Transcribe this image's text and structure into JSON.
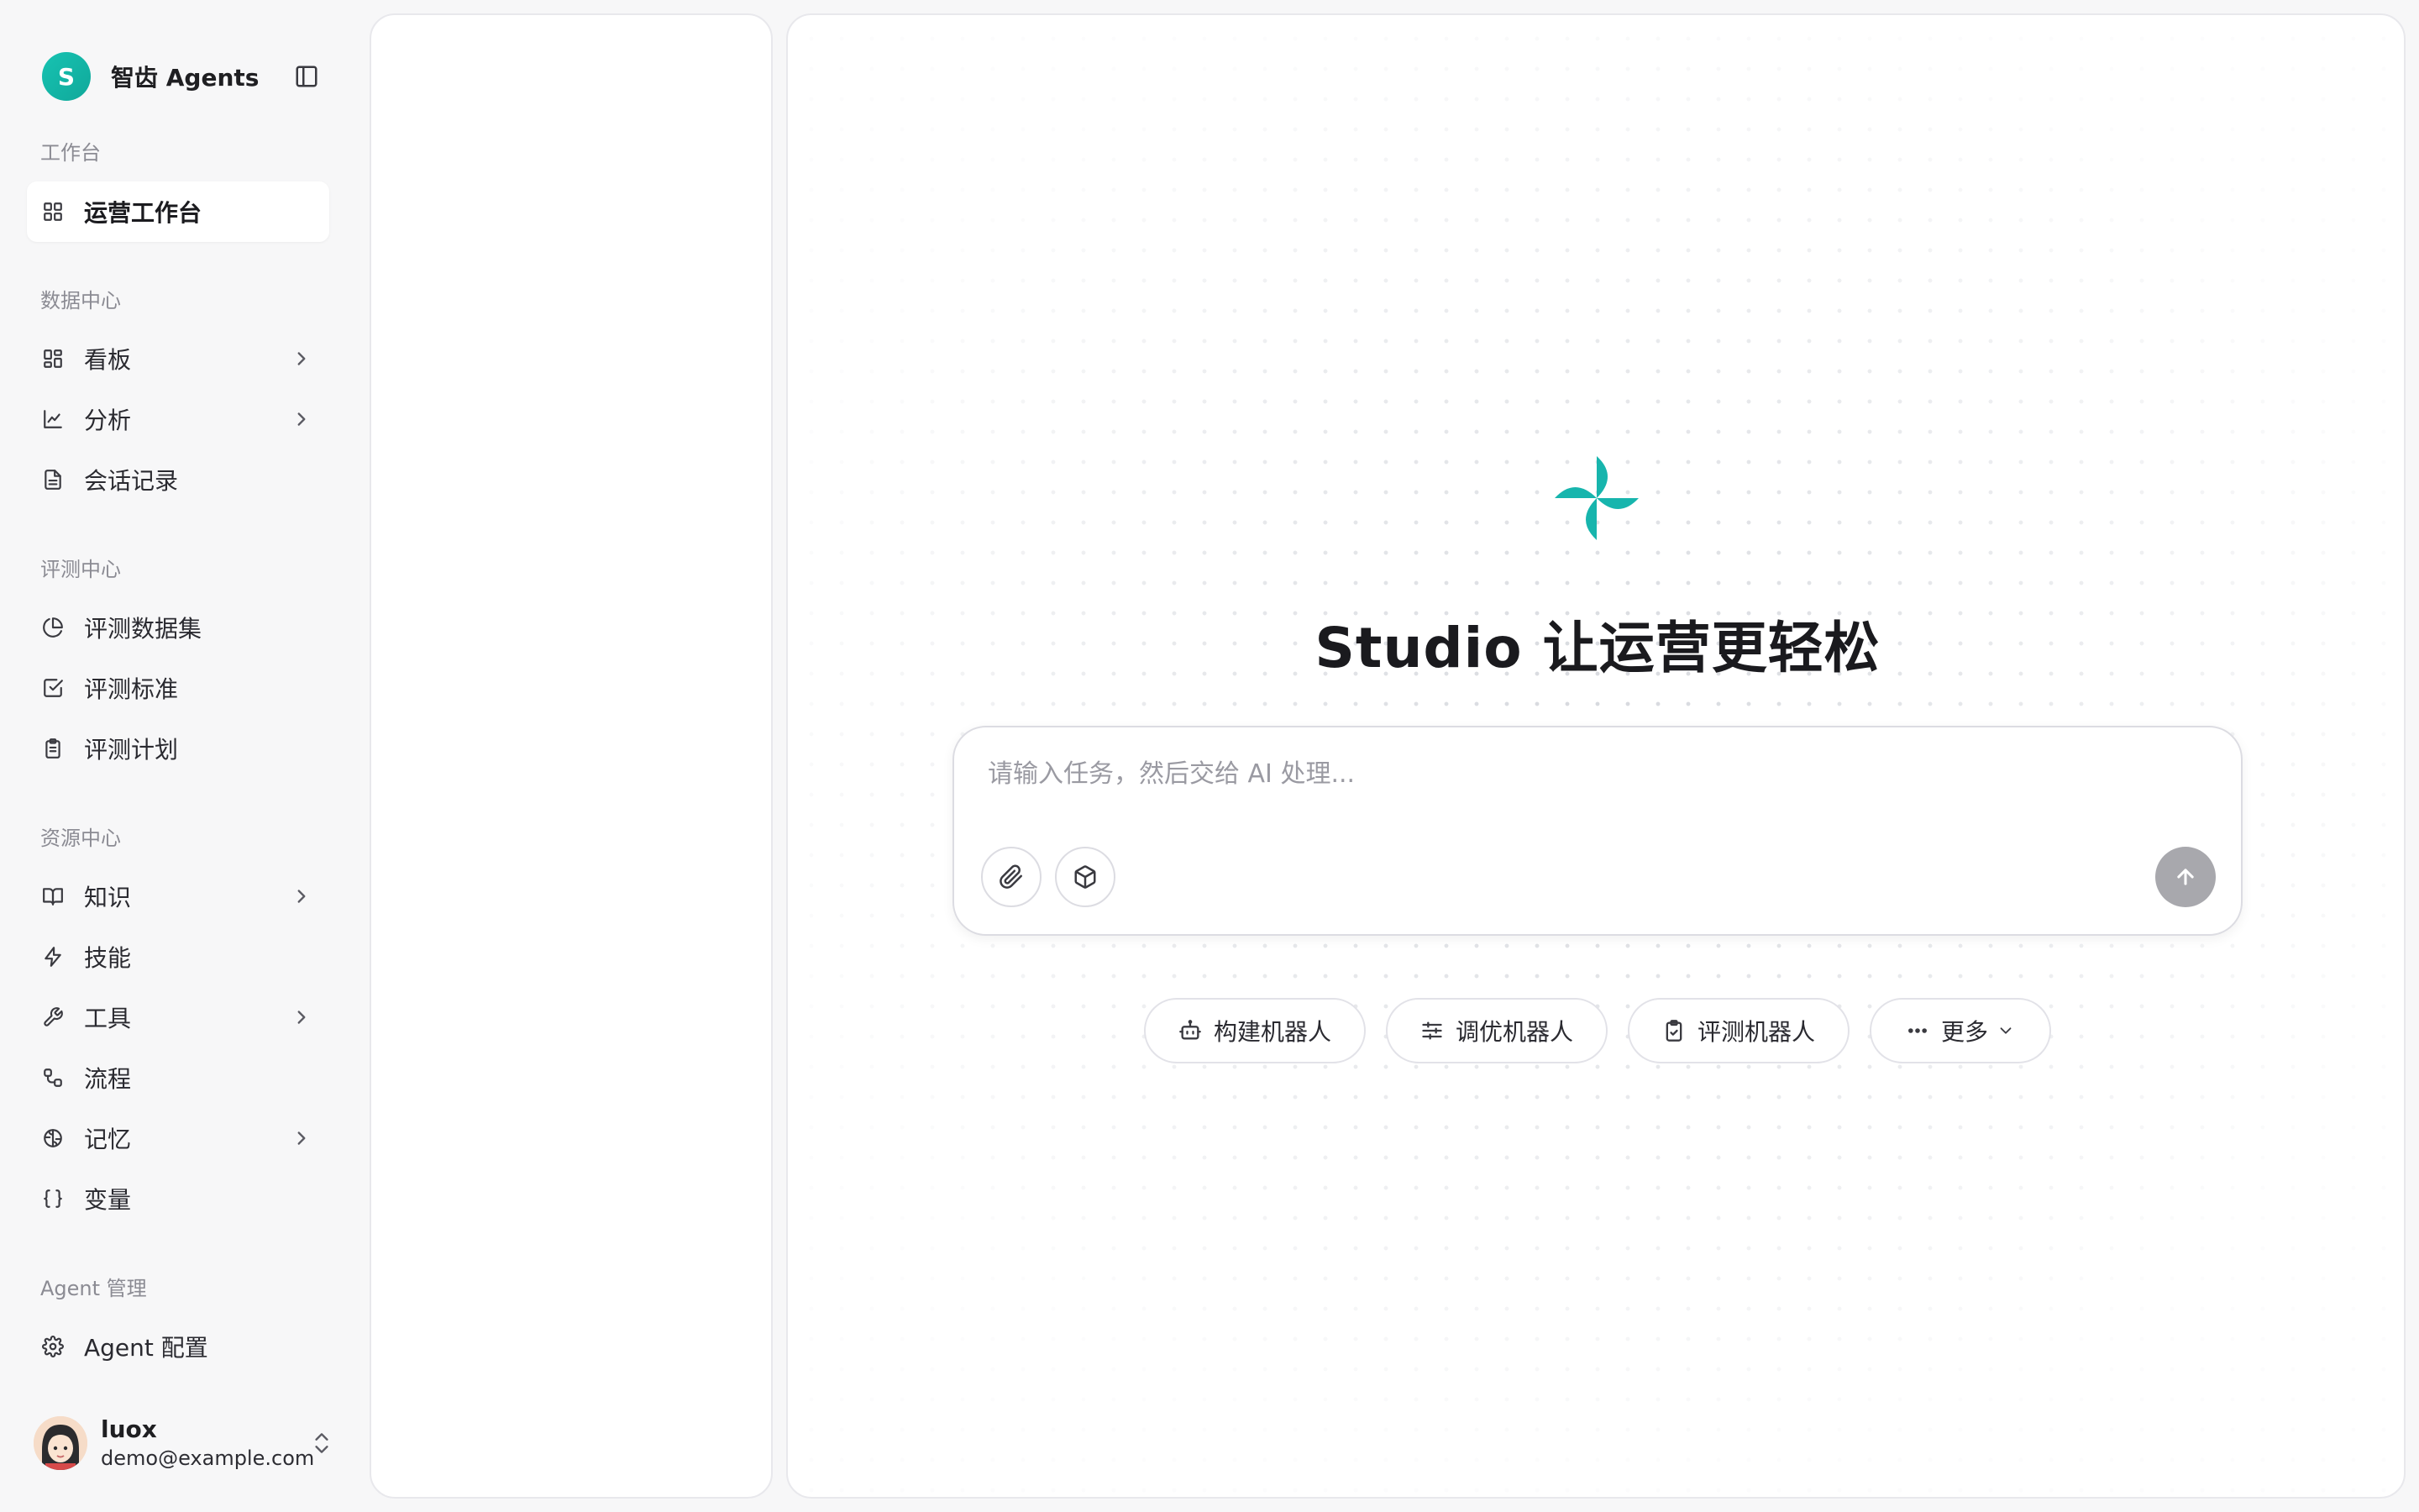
{
  "brand": {
    "logo_letter": "S",
    "name": "智齿 Agents",
    "color": "#17c3b2"
  },
  "sidebar": {
    "sections": [
      {
        "title": "工作台",
        "items": [
          {
            "label": "运营工作台",
            "icon": "grid-icon",
            "active": true,
            "chevron": false
          }
        ]
      },
      {
        "title": "数据中心",
        "items": [
          {
            "label": "看板",
            "icon": "grid-icon",
            "chevron": true
          },
          {
            "label": "分析",
            "icon": "line-chart-icon",
            "chevron": true
          },
          {
            "label": "会话记录",
            "icon": "file-text-icon",
            "chevron": false
          }
        ]
      },
      {
        "title": "评测中心",
        "items": [
          {
            "label": "评测数据集",
            "icon": "pie-chart-icon",
            "chevron": false
          },
          {
            "label": "评测标准",
            "icon": "check-square-icon",
            "chevron": false
          },
          {
            "label": "评测计划",
            "icon": "clipboard-list-icon",
            "chevron": false
          }
        ]
      },
      {
        "title": "资源中心",
        "items": [
          {
            "label": "知识",
            "icon": "book-open-icon",
            "chevron": true
          },
          {
            "label": "技能",
            "icon": "zap-icon",
            "chevron": false
          },
          {
            "label": "工具",
            "icon": "wrench-icon",
            "chevron": true
          },
          {
            "label": "流程",
            "icon": "workflow-icon",
            "chevron": false
          },
          {
            "label": "记忆",
            "icon": "brain-icon",
            "chevron": true
          },
          {
            "label": "变量",
            "icon": "braces-icon",
            "chevron": false
          }
        ]
      },
      {
        "title": "Agent 管理",
        "items": [
          {
            "label": "Agent 配置",
            "icon": "settings-icon",
            "chevron": false
          }
        ]
      }
    ]
  },
  "user": {
    "name": "luox",
    "email": "demo@example.com"
  },
  "main": {
    "title": "Studio 让运营更轻松",
    "composer": {
      "placeholder": "请输入任务，然后交给 AI 处理..."
    },
    "chips": [
      {
        "label": "构建机器人",
        "icon": "bot-icon"
      },
      {
        "label": "调优机器人",
        "icon": "sliders-icon"
      },
      {
        "label": "评测机器人",
        "icon": "clipboard-check-icon"
      },
      {
        "label": "更多",
        "icon": "more-horizontal-icon"
      }
    ]
  },
  "colors": {
    "accent": "#17b5ad",
    "send_disabled": "#a8a8ad"
  }
}
